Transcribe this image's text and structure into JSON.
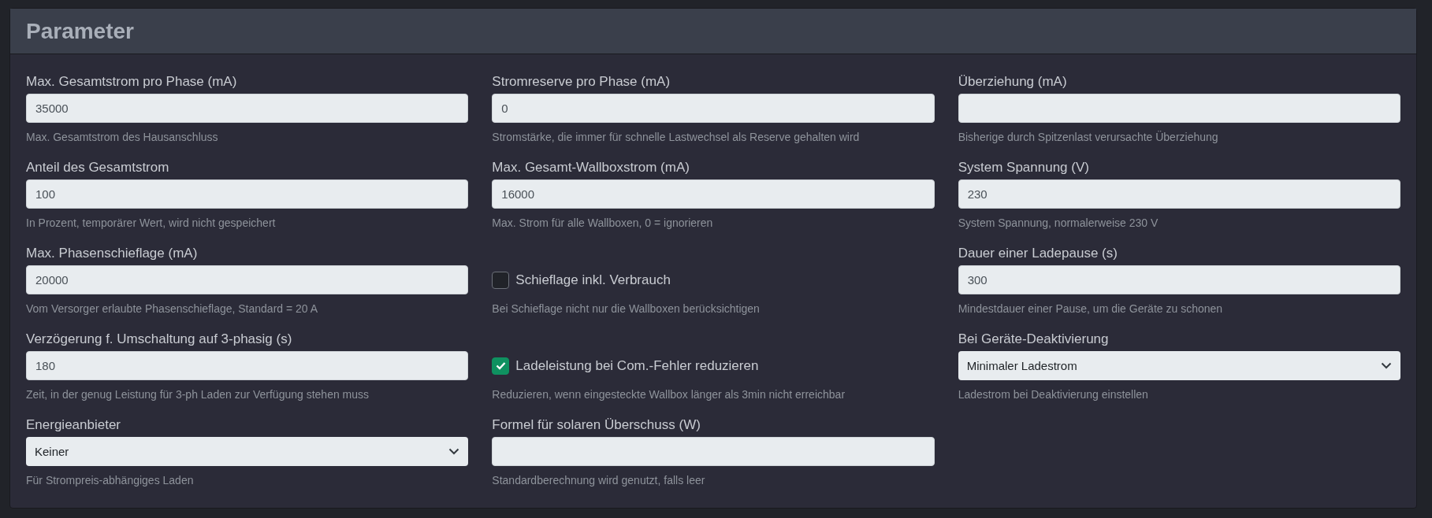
{
  "card": {
    "title": "Parameter"
  },
  "columns": [
    {
      "fields": [
        {
          "kind": "input",
          "label": "Max. Gesamtstrom pro Phase (mA)",
          "value": "35000",
          "help": "Max. Gesamtstrom des Hausanschluss"
        },
        {
          "kind": "input",
          "label": "Anteil des Gesamtstrom",
          "value": "100",
          "help": "In Prozent, temporärer Wert, wird nicht gespeichert"
        },
        {
          "kind": "input",
          "label": "Max. Phasenschieflage (mA)",
          "value": "20000",
          "help": "Vom Versorger erlaubte Phasenschieflage, Standard = 20 A"
        },
        {
          "kind": "input",
          "label": "Verzögerung f. Umschaltung auf 3-phasig (s)",
          "value": "180",
          "help": "Zeit, in der genug Leistung für 3-ph Laden zur Verfügung stehen muss"
        },
        {
          "kind": "select",
          "label": "Energieanbieter",
          "value": "Keiner",
          "help": "Für Strompreis-abhängiges Laden"
        }
      ]
    },
    {
      "fields": [
        {
          "kind": "input",
          "label": "Stromreserve pro Phase (mA)",
          "value": "0",
          "help": "Stromstärke, die immer für schnelle Lastwechsel als Reserve gehalten wird"
        },
        {
          "kind": "input",
          "label": "Max. Gesamt-Wallboxstrom (mA)",
          "value": "16000",
          "help": "Max. Strom für alle Wallboxen, 0 = ignorieren"
        },
        {
          "kind": "checkbox",
          "label": "Schieflage inkl. Verbrauch",
          "checked": false,
          "help": "Bei Schieflage nicht nur die Wallboxen berücksichtigen"
        },
        {
          "kind": "checkbox",
          "label": "Ladeleistung bei Com.-Fehler reduzieren",
          "checked": true,
          "help": "Reduzieren, wenn eingesteckte Wallbox länger als 3min nicht erreichbar"
        },
        {
          "kind": "input",
          "label": "Formel für solaren Überschuss (W)",
          "help": "Standardberechnung wird genutzt, falls leer"
        }
      ]
    },
    {
      "fields": [
        {
          "kind": "input",
          "label": "Überziehung (mA)",
          "help": "Bisherige durch Spitzenlast verursachte Überziehung"
        },
        {
          "kind": "input",
          "label": "System Spannung (V)",
          "value": "230",
          "help": "System Spannung, normalerweise 230 V"
        },
        {
          "kind": "input",
          "label": "Dauer einer Ladepause (s)",
          "value": "300",
          "help": "Mindestdauer einer Pause, um die Geräte zu schonen"
        },
        {
          "kind": "select",
          "label": "Bei Geräte-Deaktivierung",
          "value": "Minimaler Ladestrom",
          "help": "Ladestrom bei Deaktivierung einstellen"
        }
      ]
    }
  ]
}
